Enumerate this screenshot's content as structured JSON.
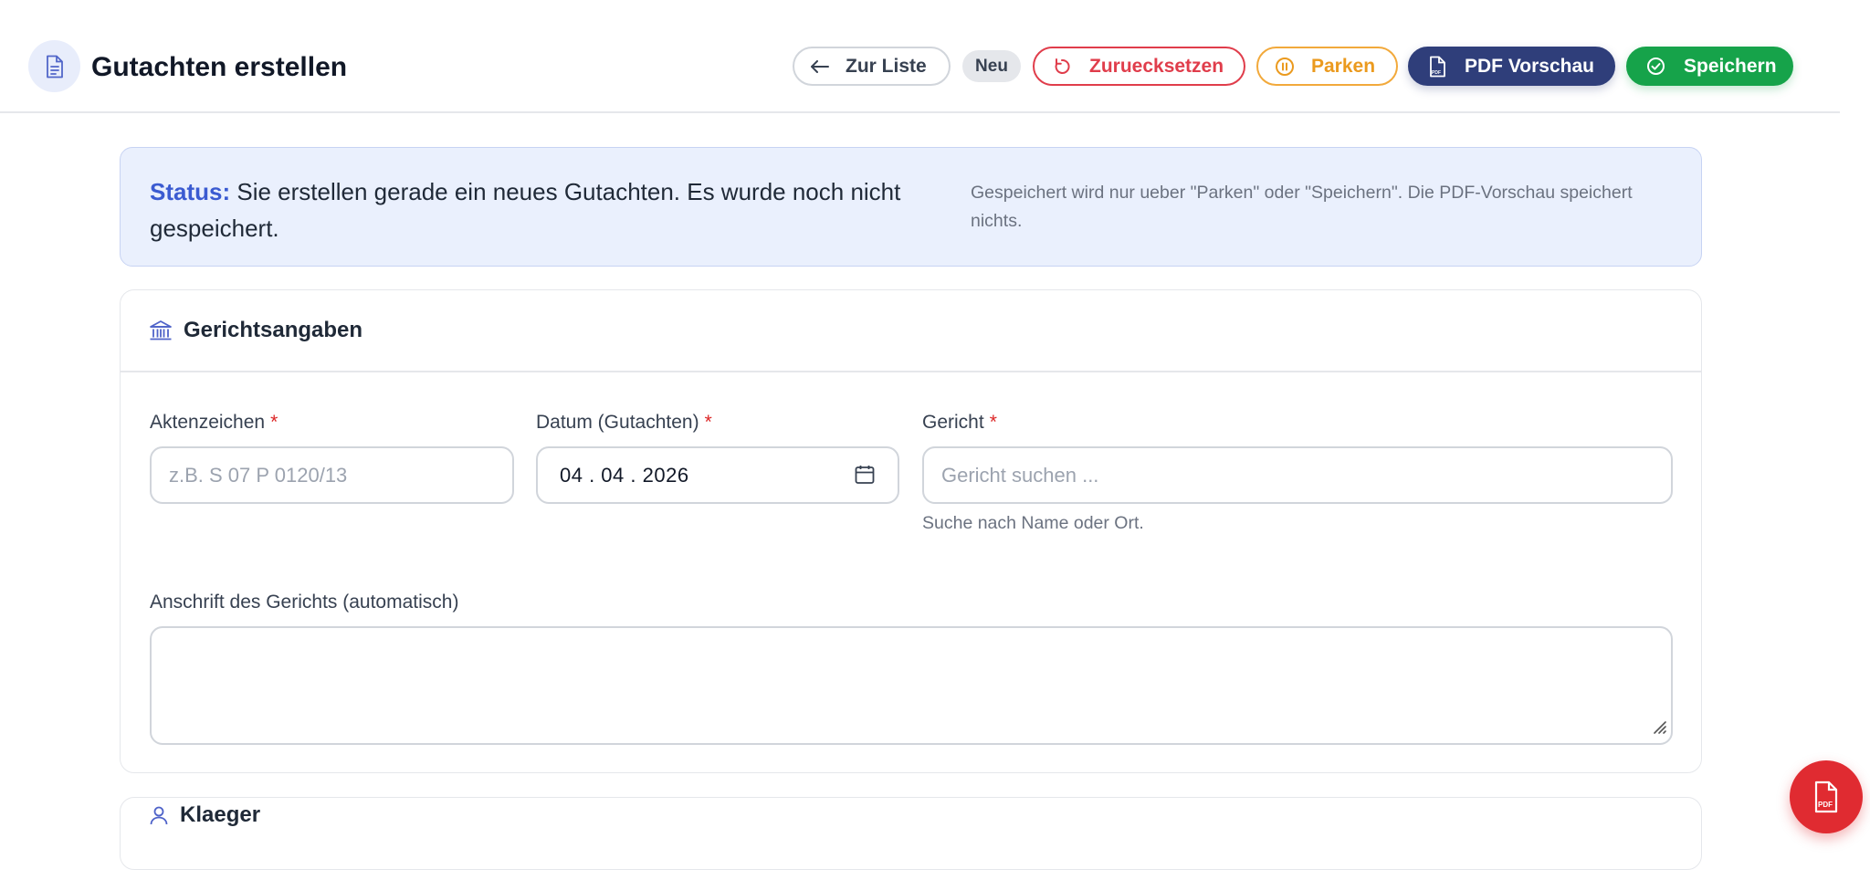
{
  "header": {
    "title": "Gutachten erstellen",
    "back_label": "Zur Liste",
    "badge": "Neu",
    "reset_label": "Zuruecksetzen",
    "park_label": "Parken",
    "pdf_label": "PDF Vorschau",
    "save_label": "Speichern"
  },
  "status": {
    "label": "Status:",
    "message": "Sie erstellen gerade ein neues Gutachten. Es wurde noch nicht gespeichert.",
    "note": "Gespeichert wird nur ueber \"Parken\" oder \"Speichern\". Die PDF-Vorschau speichert nichts."
  },
  "court_section": {
    "title": "Gerichtsangaben",
    "aktenzeichen_label": "Aktenzeichen",
    "aktenzeichen_placeholder": "z.B. S 07 P 0120/13",
    "datum_label": "Datum (Gutachten)",
    "datum_value": "04 . 04 . 2026",
    "gericht_label": "Gericht",
    "gericht_placeholder": "Gericht suchen ...",
    "gericht_hint": "Suche nach Name oder Ort.",
    "anschrift_label": "Anschrift des Gerichts (automatisch)",
    "required_mark": "*"
  },
  "klaeger_section": {
    "title": "Klaeger"
  },
  "fab": {
    "label": "PDF"
  },
  "colors": {
    "accent": "#3b5bd1",
    "danger": "#e03d4b",
    "warning": "#eb9a1e",
    "navy": "#2f3e7a",
    "success": "#16a34a"
  }
}
